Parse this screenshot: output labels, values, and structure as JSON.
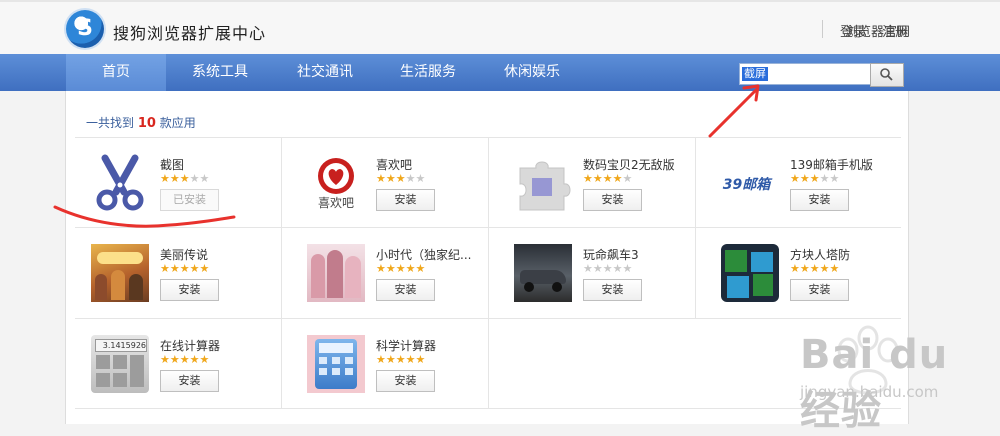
{
  "header": {
    "site_title": "搜狗浏览器扩展中心",
    "official_site": "浏览器官网",
    "login": "登录",
    "separator": "·",
    "register": "注册"
  },
  "nav": {
    "items": [
      {
        "label": "首页",
        "active": true
      },
      {
        "label": "系统工具",
        "active": false
      },
      {
        "label": "社交通讯",
        "active": false
      },
      {
        "label": "生活服务",
        "active": false
      },
      {
        "label": "休闲娱乐",
        "active": false
      }
    ],
    "search_value": "截屏"
  },
  "results": {
    "prefix": "一共找到",
    "count": "10",
    "suffix": "款应用"
  },
  "colors": {
    "nav_blue": "#4a7cc9",
    "count_red": "#d8261e",
    "star_gold": "#f0a71b",
    "annotation_red": "#e8322d"
  },
  "apps": [
    {
      "name": "截图",
      "rating": 3,
      "button": "已安装",
      "installed": true,
      "icon": "scissors-icon"
    },
    {
      "name": "喜欢吧",
      "rating": 3,
      "button": "安装",
      "installed": false,
      "icon": "heart-icon",
      "icon_text": "喜欢吧"
    },
    {
      "name": "数码宝贝2无敌版",
      "rating": 4,
      "button": "安装",
      "installed": false,
      "icon": "puzzle-icon"
    },
    {
      "name": "139邮箱手机版",
      "rating": 3,
      "button": "安装",
      "installed": false,
      "icon": "mail139-icon",
      "icon_text": "139邮箱"
    },
    {
      "name": "美丽传说",
      "rating": 5,
      "button": "安装",
      "installed": false,
      "icon": "drama-poster-icon"
    },
    {
      "name": "小时代（独家纪...",
      "rating": 5,
      "button": "安装",
      "installed": false,
      "icon": "movie-poster-icon"
    },
    {
      "name": "玩命飙车3",
      "rating": 0,
      "button": "安装",
      "installed": false,
      "icon": "race-car-icon"
    },
    {
      "name": "方块人塔防",
      "rating": 5,
      "button": "安装",
      "installed": false,
      "icon": "block-people-icon"
    },
    {
      "name": "在线计算器",
      "rating": 5,
      "button": "安装",
      "installed": false,
      "icon": "calculator-icon",
      "icon_text": "3.1415926"
    },
    {
      "name": "科学计算器",
      "rating": 5,
      "button": "安装",
      "installed": false,
      "icon": "sci-calculator-icon"
    }
  ],
  "watermark": {
    "brand": "Bai du 经验",
    "url": "jingyan.baidu.com"
  }
}
